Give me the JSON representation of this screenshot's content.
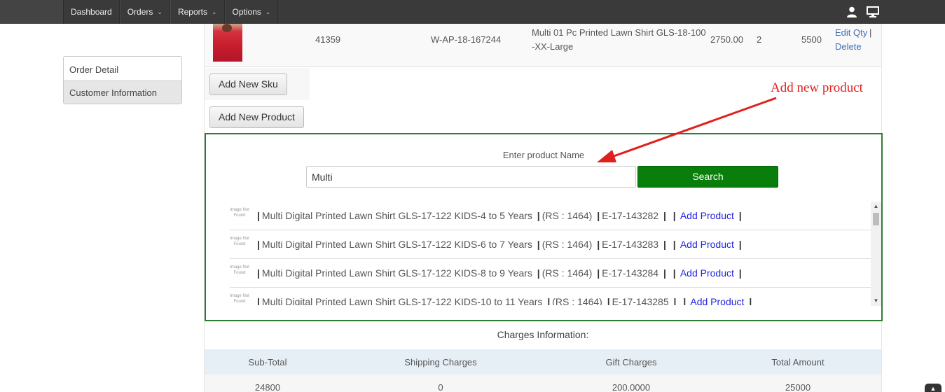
{
  "nav": {
    "items": [
      {
        "label": "Dashboard",
        "has_caret": false
      },
      {
        "label": "Orders",
        "has_caret": true
      },
      {
        "label": "Reports",
        "has_caret": true
      },
      {
        "label": "Options",
        "has_caret": true
      }
    ],
    "right_icons": [
      "user-icon",
      "monitor-icon"
    ]
  },
  "sidebar": {
    "items": [
      {
        "label": "Order Detail",
        "active": false
      },
      {
        "label": "Customer Information",
        "active": true
      }
    ]
  },
  "order_item": {
    "id": "41359",
    "sku": "W-AP-18-167244",
    "name_line1": "Multi 01 Pc Printed Lawn Shirt GLS-18-100",
    "name_line2": "-XX-Large",
    "price": "2750.00",
    "qty": "2",
    "total": "5500",
    "edit_label": "Edit Qty",
    "delete_label": "Delete",
    "separator": "|"
  },
  "buttons": {
    "add_sku": "Add New Sku",
    "add_product": "Add New Product"
  },
  "search": {
    "label": "Enter product Name",
    "value": "Multi",
    "button": "Search"
  },
  "results": [
    {
      "img_text": "Image Not Found",
      "name": "Multi Digital Printed Lawn Shirt GLS-17-122 KIDS-4 to 5 Years",
      "price": "(RS : 1464)",
      "code": "E-17-143282",
      "action": "Add Product"
    },
    {
      "img_text": "Image Not Found",
      "name": "Multi Digital Printed Lawn Shirt GLS-17-122 KIDS-6 to 7 Years",
      "price": "(RS : 1464)",
      "code": "E-17-143283",
      "action": "Add Product"
    },
    {
      "img_text": "Image Not Found",
      "name": "Multi Digital Printed Lawn Shirt GLS-17-122 KIDS-8 to 9 Years",
      "price": "(RS : 1464)",
      "code": "E-17-143284",
      "action": "Add Product"
    },
    {
      "img_text": "Image Not Found",
      "name": "Multi Digital Printed Lawn Shirt GLS-17-122 KIDS-10 to 11 Years",
      "price": "(RS : 1464)",
      "code": "E-17-143285",
      "action": "Add Product"
    }
  ],
  "charges": {
    "title": "Charges Information:",
    "headers": [
      "Sub-Total",
      "Shipping Charges",
      "Gift Charges",
      "Total Amount"
    ],
    "values": [
      "24800",
      "0",
      "200.0000",
      "25000"
    ]
  },
  "annotation": {
    "text": "Add new product",
    "color": "#e0201e"
  },
  "colors": {
    "nav_bg": "#3a3a3a",
    "search_btn": "#0a7e0a",
    "panel_border": "#2e7d32",
    "link": "#2323e0"
  }
}
